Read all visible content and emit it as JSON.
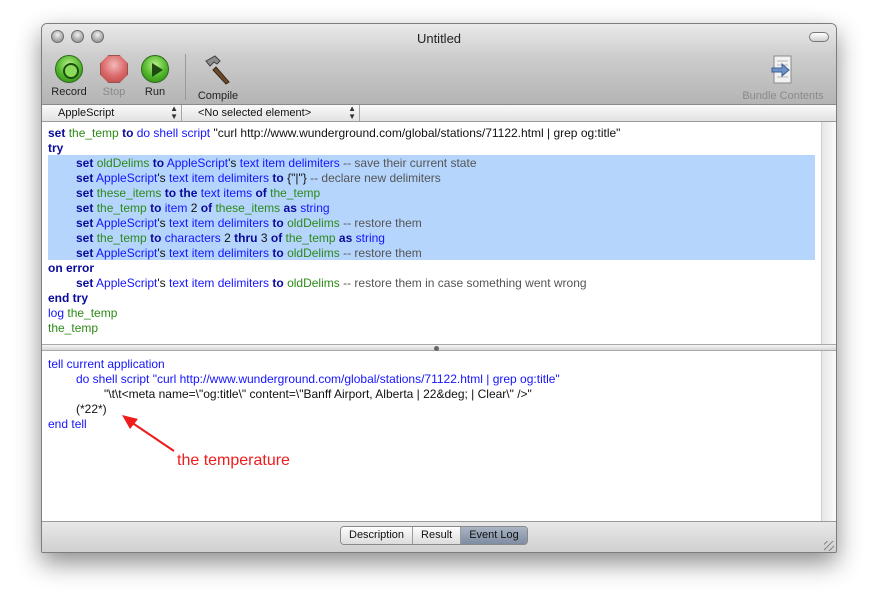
{
  "window": {
    "title": "Untitled"
  },
  "toolbar": {
    "record_label": "Record",
    "stop_label": "Stop",
    "run_label": "Run",
    "compile_label": "Compile",
    "bundle_label": "Bundle Contents"
  },
  "navbar": {
    "language": "AppleScript",
    "element": "<No selected element>"
  },
  "script": {
    "l1": {
      "a": "set",
      "b": "the_temp",
      "c": "to",
      "d": "do shell script",
      "e": "\"curl http://www.wunderground.com/global/stations/71122.html | grep og:title\""
    },
    "l2": {
      "a": "try"
    },
    "l3": {
      "a": "set",
      "b": "oldDelims",
      "c": "to",
      "d": "AppleScript",
      "e": "'s",
      "f": "text item delimiters",
      "g": "-- save their current state"
    },
    "l4": {
      "a": "set",
      "b": "AppleScript",
      "c": "'s",
      "d": "text item delimiters",
      "e": "to",
      "f": "{\"|\"}",
      "g": "-- declare new delimiters"
    },
    "l5": {
      "a": "set",
      "b": "these_items",
      "c": "to the",
      "d": "text items",
      "e": "of",
      "f": "the_temp"
    },
    "l6": {
      "a": "set",
      "b": "the_temp",
      "c": "to",
      "d": "item",
      "e": "2",
      "f": "of",
      "g": "these_items",
      "h": "as",
      "i": "string"
    },
    "l7": {
      "a": "set",
      "b": "AppleScript",
      "c": "'s",
      "d": "text item delimiters",
      "e": "to",
      "f": "oldDelims",
      "g": "-- restore them"
    },
    "l8": {
      "a": "set",
      "b": "the_temp",
      "c": "to",
      "d": "characters",
      "e": "2",
      "f": "thru",
      "g": "3",
      "h": "of",
      "i": "the_temp",
      "j": "as",
      "k": "string"
    },
    "l9": {
      "a": "set",
      "b": "AppleScript",
      "c": "'s",
      "d": "text item delimiters",
      "e": "to",
      "f": "oldDelims",
      "g": "-- restore them"
    },
    "l10": {
      "a": "on error"
    },
    "l11": {
      "a": "set",
      "b": "AppleScript",
      "c": "'s",
      "d": "text item delimiters",
      "e": "to",
      "f": "oldDelims",
      "g": "-- restore them in case something went wrong"
    },
    "l12": {
      "a": "end try"
    },
    "l13": {
      "a": "log",
      "b": "the_temp"
    },
    "l14": {
      "a": "the_temp"
    }
  },
  "log": {
    "l1": "tell current application",
    "l2": "do shell script \"curl http://www.wunderground.com/global/stations/71122.html | grep og:title\"",
    "l3": "\"\\t\\t<meta name=\\\"og:title\\\" content=\\\"Banff Airport, Alberta | 22&deg; | Clear\\\" />\"",
    "l4": "(*22*)",
    "l5": "end tell"
  },
  "annotation": {
    "text": "the temperature",
    "color": "#ee1c1c"
  },
  "tabs": {
    "description": "Description",
    "result": "Result",
    "event_log": "Event Log",
    "active": "event_log"
  }
}
